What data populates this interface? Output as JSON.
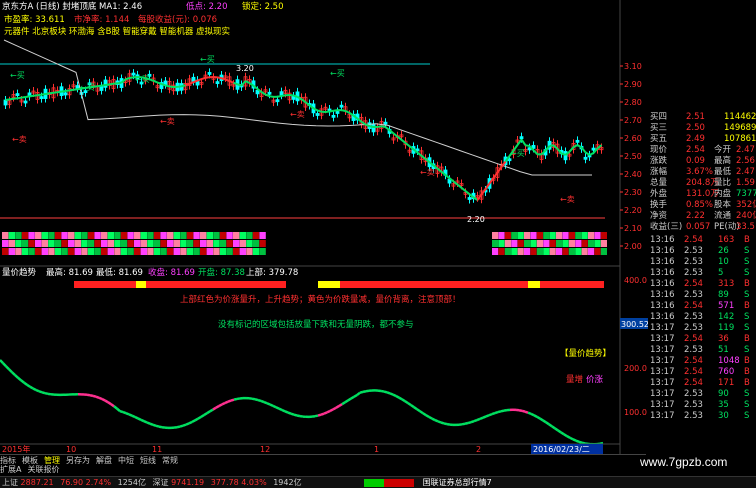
{
  "header": {
    "title_line": "京东方A (日线) 封堵顶底 MA1: 2.46",
    "low_label": "低点: 2.20",
    "lock_label": "锁定: 2.50",
    "pe_label": "市盈率: 33.611",
    "pb_label": "市净率: 1.144",
    "eps_label": "每股收益(元): 0.076",
    "concepts": "元器件 北京板块 环渤海 含B股 智能穿戴 智能机器 虚拟现实"
  },
  "main_chart": {
    "price_axis": [
      "3.10",
      "2.90",
      "2.80",
      "2.70",
      "2.60",
      "2.50",
      "2.40",
      "2.30",
      "2.20",
      "2.10",
      "2.00"
    ],
    "high_label": "3.20",
    "low_label": "2.20",
    "buy_label": "买",
    "sell_label": "卖",
    "buy_signals": [
      "←买",
      "←买",
      "←买",
      "←买",
      "←买",
      "←买"
    ],
    "sell_signals": [
      "←卖",
      "←卖",
      "←卖",
      "←卖",
      "←卖"
    ]
  },
  "indicator": {
    "title": "量价趋势",
    "high": "最高: 81.69",
    "low": "最低: 81.69",
    "close": "收盘: 81.69",
    "open": "开盘: 87.38",
    "upper": "上部: 379.78",
    "desc1": "上部红色为价涨量升，上升趋势；黄色为价跌量减，量价背离，注意顶部！",
    "desc2": "没有标记的区域包括放量下跌和无量阴跌，都不参与",
    "legend_label": "【量价趋势】",
    "legend_vol": "量增",
    "legend_price": "价涨",
    "axis": [
      "400.0",
      "300.0",
      "200.0",
      "100.0"
    ],
    "cursor_value": "300.52"
  },
  "time_axis": {
    "labels": [
      "2015年",
      "10",
      "11",
      "12",
      "1",
      "2"
    ],
    "cursor_date": "2016/02/23/二"
  },
  "side_panel": {
    "quotes": [
      {
        "l": "买四",
        "v": "2.51",
        "n": "114462"
      },
      {
        "l": "买三",
        "v": "2.50",
        "n": "149689"
      },
      {
        "l": "买五",
        "v": "2.49",
        "n": "107861"
      },
      {
        "l": "现价",
        "v": "2.54",
        "l2": "今开",
        "v2": "2.47"
      },
      {
        "l": "涨跌",
        "v": "0.09",
        "l2": "最高",
        "v2": "2.56"
      },
      {
        "l": "涨幅",
        "v": "3.67%",
        "l2": "最低",
        "v2": "2.47"
      },
      {
        "l": "总量",
        "v": "204.8万",
        "l2": "量比",
        "v2": "1.59"
      },
      {
        "l": "外盘",
        "v": "131.0万",
        "l2": "内盘",
        "v2": "737700"
      },
      {
        "l": "换手",
        "v": "0.85%",
        "l2": "股本",
        "v2": "352亿"
      },
      {
        "l": "净资",
        "v": "2.22",
        "l2": "流通",
        "v2": "240亿"
      },
      {
        "l": "收益(三)",
        "v": "0.057",
        "l2": "PE(动)",
        "v2": "33.5"
      }
    ],
    "ticks": [
      {
        "t": "13:16",
        "p": "2.54",
        "v": "163",
        "s": "B"
      },
      {
        "t": "13:16",
        "p": "2.53",
        "v": "26",
        "s": "S"
      },
      {
        "t": "13:16",
        "p": "2.53",
        "v": "10",
        "s": "S"
      },
      {
        "t": "13:16",
        "p": "2.53",
        "v": "5",
        "s": "S"
      },
      {
        "t": "13:16",
        "p": "2.54",
        "v": "313",
        "s": "B"
      },
      {
        "t": "13:16",
        "p": "2.53",
        "v": "89",
        "s": "S"
      },
      {
        "t": "13:16",
        "p": "2.54",
        "v": "571",
        "s": "B"
      },
      {
        "t": "13:16",
        "p": "2.53",
        "v": "142",
        "s": "S"
      },
      {
        "t": "13:17",
        "p": "2.53",
        "v": "119",
        "s": "S"
      },
      {
        "t": "13:17",
        "p": "2.54",
        "v": "36",
        "s": "B"
      },
      {
        "t": "13:17",
        "p": "2.53",
        "v": "51",
        "s": "S"
      },
      {
        "t": "13:17",
        "p": "2.54",
        "v": "1048",
        "s": "B"
      },
      {
        "t": "13:17",
        "p": "2.54",
        "v": "760",
        "s": "B"
      },
      {
        "t": "13:17",
        "p": "2.54",
        "v": "171",
        "s": "B"
      },
      {
        "t": "13:17",
        "p": "2.53",
        "v": "90",
        "s": "S"
      },
      {
        "t": "13:17",
        "p": "2.53",
        "v": "35",
        "s": "S"
      },
      {
        "t": "13:17",
        "p": "2.53",
        "v": "30",
        "s": "S"
      }
    ]
  },
  "bottom_tabs": [
    "指标",
    "模板",
    "管理",
    "另存为",
    "解盘",
    "中短",
    "短线",
    "常规"
  ],
  "bottom_tabs2": [
    "扩展A",
    "关联报价"
  ],
  "status_bar": {
    "sh_label": "上证",
    "sh_value": "2887.21",
    "sh_change": "76.90",
    "sh_pct": "2.74%",
    "sh_amount": "1254亿",
    "sz_label": "深证",
    "sz_value": "9741.19",
    "sz_change": "377.78",
    "sz_pct": "4.03%",
    "sz_amount": "1942亿",
    "notice": "国联证券总部行情7"
  },
  "watermark": "www.7gpzb.com",
  "colors": {
    "up": "#ff3030",
    "down": "#00ffff",
    "ma": "#ffffff",
    "trend_green": "#00e060",
    "trend_pink": "#ff3090",
    "yellow": "#ffff00"
  }
}
